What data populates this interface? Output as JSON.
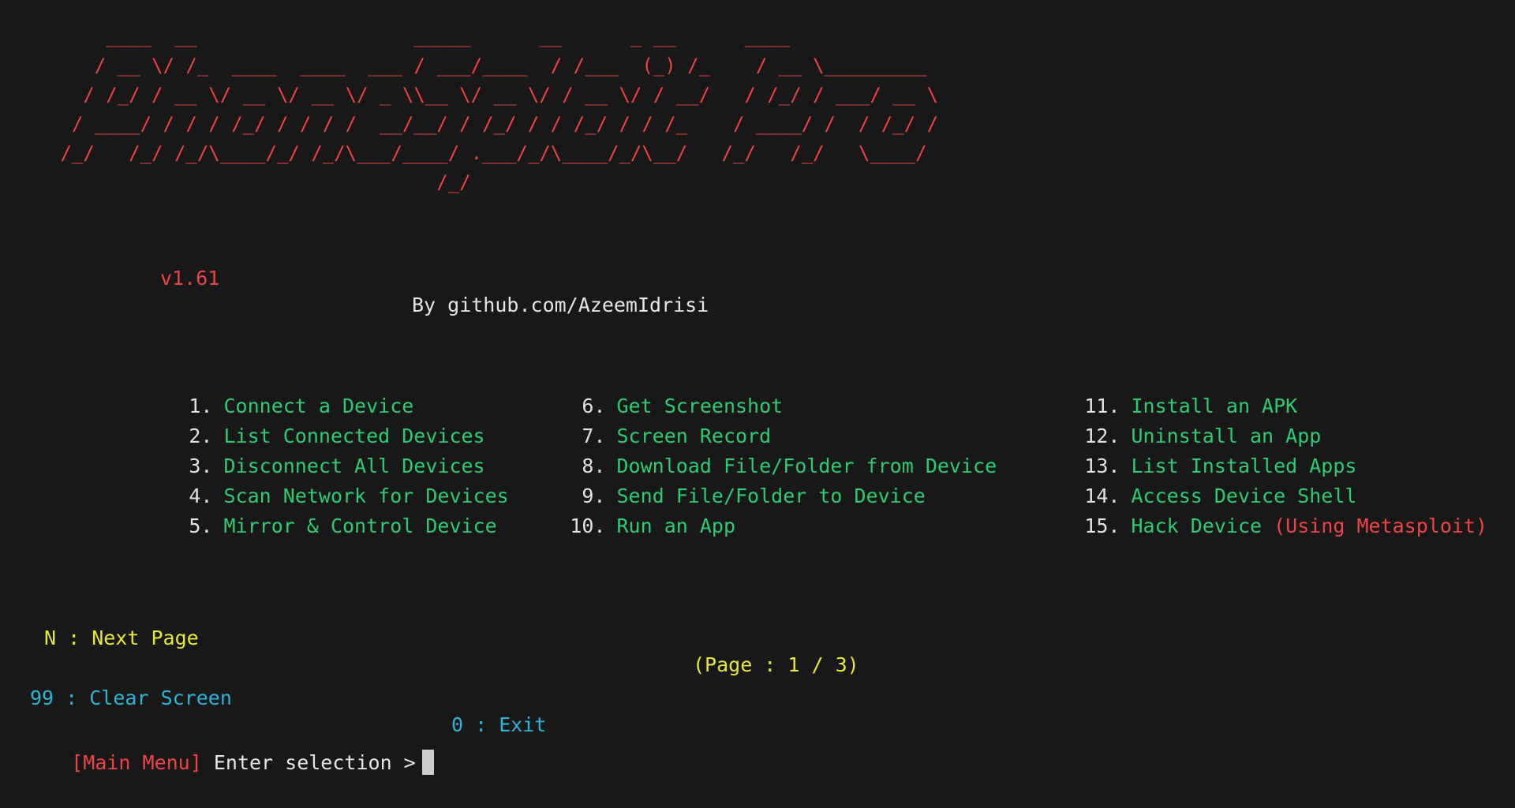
{
  "app": {
    "name": "PhoneSploit Pro",
    "version_label": "v1.61",
    "author_label": "By github.com/AzeemIdrisi",
    "banner_ascii": "     ____  __                   _____      __      _ __      ____\n    / __ \\/ /_  ____  ____  ___ / ___/____  / /___  (_) /_    / __ \\_________\n   / /_/ / __ \\/ __ \\/ __ \\/ _ \\\\__ \\/ __ \\/ / __ \\/ / __/   / /_/ / ___/ __ \\\n  / ____/ / / / /_/ / / / /  __/__/ / /_/ / / /_/ / / /_    / ____/ /  / /_/ /\n /_/   /_/ /_/\\____/_/ /_/\\___/____/ .___/_/\\____/_/\\__/   /_/   /_/   \\____/\n                                  /_/"
  },
  "colors": {
    "background": "#181818",
    "banner_red": "#ef4444",
    "menu_green": "#2ecc71",
    "menu_number": "#e2e2e2",
    "yellow": "#e8e838",
    "cyan": "#29b6d8",
    "white": "#e6e6e6",
    "cursor": "#cccccc"
  },
  "menu": {
    "columns": [
      {
        "items": [
          {
            "number": "1",
            "dot": ".",
            "label": "Connect a Device",
            "suffix": ""
          },
          {
            "number": "2",
            "dot": ".",
            "label": "List Connected Devices",
            "suffix": ""
          },
          {
            "number": "3",
            "dot": ".",
            "label": "Disconnect All Devices",
            "suffix": ""
          },
          {
            "number": "4",
            "dot": ".",
            "label": "Scan Network for Devices",
            "suffix": ""
          },
          {
            "number": "5",
            "dot": ".",
            "label": "Mirror & Control Device",
            "suffix": ""
          }
        ]
      },
      {
        "items": [
          {
            "number": "6",
            "dot": ".",
            "label": "Get Screenshot",
            "suffix": ""
          },
          {
            "number": "7",
            "dot": ".",
            "label": "Screen Record",
            "suffix": ""
          },
          {
            "number": "8",
            "dot": ".",
            "label": "Download File/Folder from Device",
            "suffix": ""
          },
          {
            "number": "9",
            "dot": ".",
            "label": "Send File/Folder to Device",
            "suffix": ""
          },
          {
            "number": "10",
            "dot": ".",
            "label": "Run an App",
            "suffix": ""
          }
        ]
      },
      {
        "items": [
          {
            "number": "11",
            "dot": ".",
            "label": "Install an APK",
            "suffix": ""
          },
          {
            "number": "12",
            "dot": ".",
            "label": "Uninstall an App",
            "suffix": ""
          },
          {
            "number": "13",
            "dot": ".",
            "label": "List Installed Apps",
            "suffix": ""
          },
          {
            "number": "14",
            "dot": ".",
            "label": "Access Device Shell",
            "suffix": ""
          },
          {
            "number": "15",
            "dot": ".",
            "label": "Hack Device ",
            "suffix": "(Using Metasploit)"
          }
        ]
      }
    ]
  },
  "footer": {
    "next_page": "N : Next Page",
    "page_indicator": "(Page : 1 / 3)",
    "clear_screen": "99 : Clear Screen",
    "exit": "0 : Exit"
  },
  "prompt": {
    "context": "[Main Menu]",
    "text": " Enter selection >",
    "input_value": ""
  }
}
